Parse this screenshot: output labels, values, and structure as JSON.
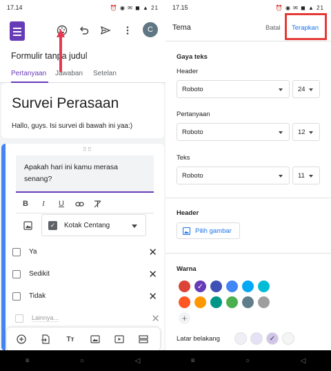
{
  "left": {
    "status": {
      "time": "17.14",
      "icons": "⏰ ◉ ✉ ◼ ▲ 21"
    },
    "toolbar": {
      "avatar": "C"
    },
    "form_title": "Formulir tanpa judul",
    "tabs": [
      {
        "label": "Pertanyaan"
      },
      {
        "label": "Jawaban"
      },
      {
        "label": "Setelan"
      }
    ],
    "survey": {
      "title": "Survei Perasaan",
      "description": "Hallo, guys. Isi survei di bawah ini yaa:)"
    },
    "question": {
      "text": "Apakah hari ini kamu merasa senang?",
      "type": "Kotak Centang",
      "options": [
        {
          "label": "Ya"
        },
        {
          "label": "Sedikit"
        },
        {
          "label": "Tidak"
        }
      ],
      "other_placeholder": "Lainnya..."
    },
    "format_icons": [
      "B",
      "I",
      "U"
    ],
    "bottom_tool_text_icon": "Tт"
  },
  "right": {
    "status": {
      "time": "17.15",
      "icons": "⏰ ◉ ✉ ◼ ▲ 21"
    },
    "title": "Tema",
    "cancel_label": "Batal",
    "apply_label": "Terapkan",
    "text_style": {
      "heading": "Gaya teks",
      "header": {
        "label": "Header",
        "font": "Roboto",
        "size": "24"
      },
      "question": {
        "label": "Pertanyaan",
        "font": "Roboto",
        "size": "12"
      },
      "text": {
        "label": "Teks",
        "font": "Roboto",
        "size": "11"
      }
    },
    "header_section": {
      "heading": "Header",
      "button": "Pilih gambar"
    },
    "color_section": {
      "heading": "Warna",
      "colors": [
        "#db4437",
        "#673ab7",
        "#3f51b5",
        "#4285f4",
        "#03a9f4",
        "#00bcd4",
        "#ff5722",
        "#ff9800",
        "#009688",
        "#4caf50",
        "#607d8b",
        "#9e9e9e"
      ],
      "selected": "#673ab7",
      "add_symbol": "+",
      "background_label": "Latar belakang",
      "background_colors": [
        "#f0eff5",
        "#e6e1f4",
        "#d1c4e9",
        "#f5f5f5"
      ],
      "background_selected": "#d1c4e9"
    }
  },
  "nav": {
    "symbols": [
      "≡",
      "○",
      "◁"
    ]
  },
  "colors": {
    "accent": "#673ab7",
    "link": "#1a73e8",
    "highlight": "#e53935"
  }
}
